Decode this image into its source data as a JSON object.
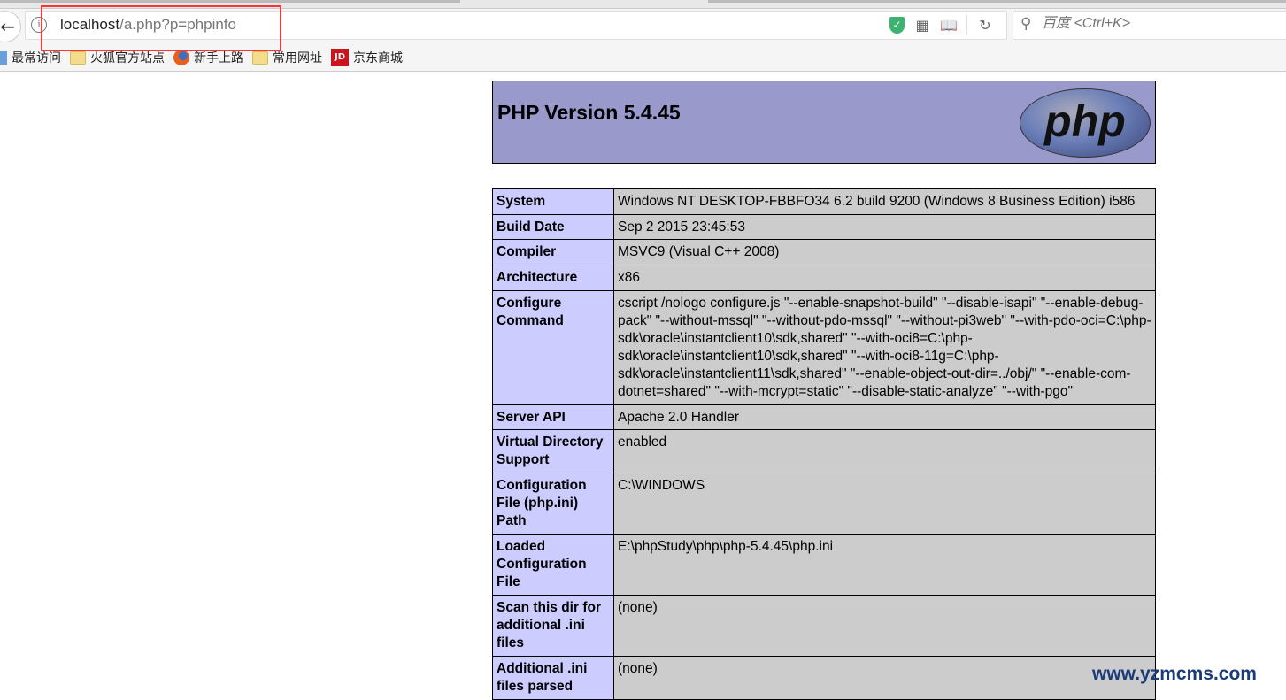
{
  "browser": {
    "url_host": "localhost",
    "url_path": "/a.php?p=phpinfo",
    "search_placeholder": "百度 <Ctrl+K>",
    "bookmarks": [
      "最常访问",
      "火狐官方站点",
      "新手上路",
      "常用网址",
      "京东商城"
    ],
    "jd_logo": "JD"
  },
  "page": {
    "title": "PHP Version 5.4.45",
    "logo_text": "php",
    "rows": [
      {
        "k": "System",
        "v": "Windows NT DESKTOP-FBBFO34 6.2 build 9200 (Windows 8 Business Edition) i586"
      },
      {
        "k": "Build Date",
        "v": "Sep 2 2015 23:45:53"
      },
      {
        "k": "Compiler",
        "v": "MSVC9 (Visual C++ 2008)"
      },
      {
        "k": "Architecture",
        "v": "x86"
      },
      {
        "k": "Configure Command",
        "v": "cscript /nologo configure.js \"--enable-snapshot-build\" \"--disable-isapi\" \"--enable-debug-pack\" \"--without-mssql\" \"--without-pdo-mssql\" \"--without-pi3web\" \"--with-pdo-oci=C:\\php-sdk\\oracle\\instantclient10\\sdk,shared\" \"--with-oci8=C:\\php-sdk\\oracle\\instantclient10\\sdk,shared\" \"--with-oci8-11g=C:\\php-sdk\\oracle\\instantclient11\\sdk,shared\" \"--enable-object-out-dir=../obj/\" \"--enable-com-dotnet=shared\" \"--with-mcrypt=static\" \"--disable-static-analyze\" \"--with-pgo\""
      },
      {
        "k": "Server API",
        "v": "Apache 2.0 Handler"
      },
      {
        "k": "Virtual Directory Support",
        "v": "enabled"
      },
      {
        "k": "Configuration File (php.ini) Path",
        "v": "C:\\WINDOWS"
      },
      {
        "k": "Loaded Configuration File",
        "v": "E:\\phpStudy\\php\\php-5.4.45\\php.ini"
      },
      {
        "k": "Scan this dir for additional .ini files",
        "v": "(none)"
      },
      {
        "k": "Additional .ini files parsed",
        "v": "(none)"
      }
    ]
  },
  "watermark": "www.yzmcms.com"
}
